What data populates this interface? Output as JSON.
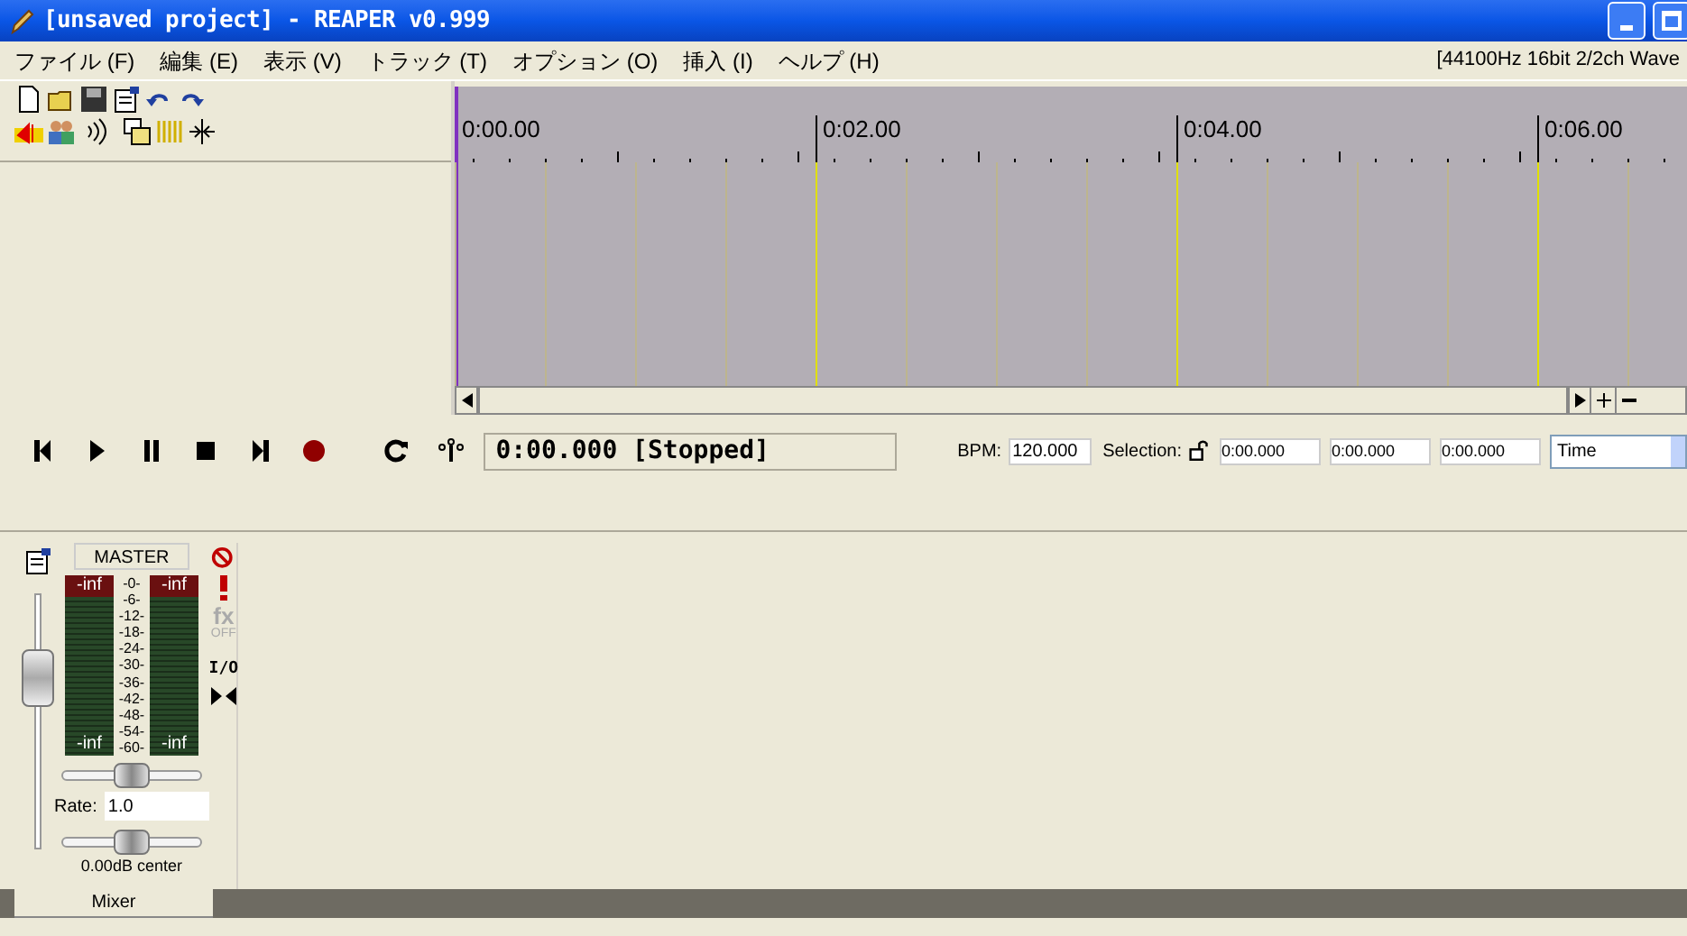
{
  "window": {
    "title": "[unsaved project] - REAPER v0.999"
  },
  "menu": [
    "ファイル (F)",
    "編集 (E)",
    "表示 (V)",
    "トラック (T)",
    "オプション (O)",
    "挿入 (I)",
    "ヘルプ (H)"
  ],
  "status": "[44100Hz 16bit 2/2ch Wave",
  "timeline": {
    "labels": [
      "0:00.00",
      "0:02.00",
      "0:04.00",
      "0:06.00"
    ]
  },
  "transport": {
    "time": "0:00.000 [Stopped]",
    "bpm_label": "BPM:",
    "bpm": "120.000",
    "selection_label": "Selection:",
    "selection": [
      "0:00.000",
      "0:00.000",
      "0:00.000"
    ],
    "mode": "Time"
  },
  "mixer": {
    "name": "MASTER",
    "peak_left": "-inf",
    "peak_right": "-inf",
    "scale": [
      "-0-",
      "-6-",
      "-12-",
      "-18-",
      "-24-",
      "-30-",
      "-36-",
      "-42-",
      "-48-",
      "-54-",
      "-60-"
    ],
    "level_left": "-inf",
    "level_right": "-inf",
    "fx": "fx",
    "fx_state": "OFF",
    "io": "I/O",
    "volume": {
      "level": 0.72
    },
    "pan": {
      "level": 0.5
    },
    "rate_label": "Rate:",
    "rate": "1.0",
    "rate_slider": {
      "level": 0.5
    },
    "readout": "0.00dB center",
    "tab": "Mixer"
  }
}
